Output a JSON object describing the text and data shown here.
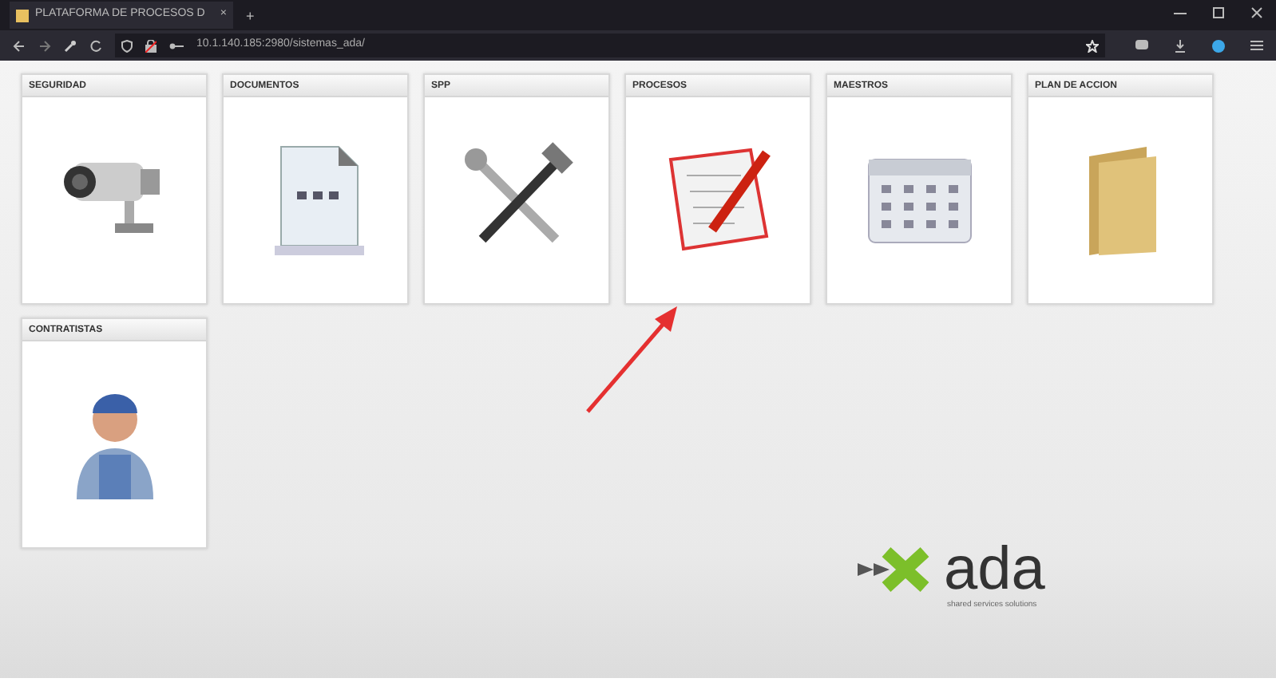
{
  "browser": {
    "tab_title": "PLATAFORMA DE PROCESOS D",
    "tab_close": "×",
    "new_tab": "+",
    "url": "10.1.140.185:2980/sistemas_ada/"
  },
  "tiles": [
    {
      "title": "SEGURIDAD",
      "kind": "camera"
    },
    {
      "title": "DOCUMENTOS",
      "kind": "document"
    },
    {
      "title": "SPP",
      "kind": "tools"
    },
    {
      "title": "PROCESOS",
      "kind": "process"
    },
    {
      "title": "MAESTROS",
      "kind": "calendar"
    },
    {
      "title": "PLAN DE ACCION",
      "kind": "folder"
    },
    {
      "title": "CONTRATISTAS",
      "kind": "worker"
    }
  ],
  "logo": {
    "name": "ada",
    "tagline": "shared services solutions"
  }
}
